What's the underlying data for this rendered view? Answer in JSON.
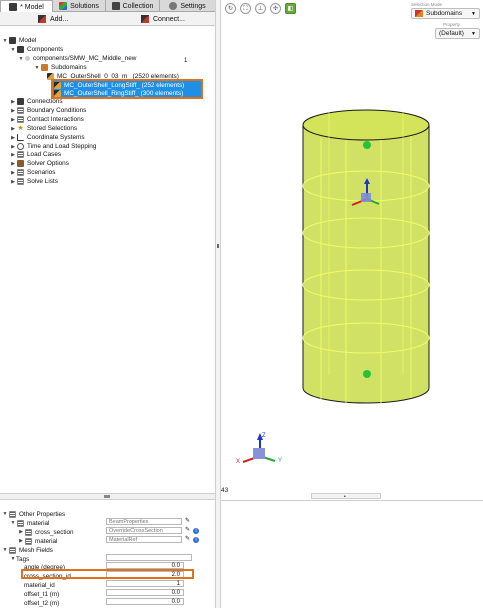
{
  "tabs": [
    {
      "label": "* Model",
      "icon": "model-icon"
    },
    {
      "label": "Solutions",
      "icon": "solutions-icon"
    },
    {
      "label": "Collection",
      "icon": "collection-icon"
    },
    {
      "label": "Settings",
      "icon": "settings-icon"
    }
  ],
  "toolbar": {
    "add_label": "Add...",
    "connect_label": "Connect..."
  },
  "tree": {
    "model": "Model",
    "components": "Components",
    "component_file": "components/SMW_MC_Middle_new",
    "component_count": "1",
    "subdomains": "Subdomains",
    "sub1": "MC_OuterShell_0_03_m_ (2520 elements)",
    "sub2": "MC_OuterShell_LongStiff_ (252 elements)",
    "sub3": "MC_OuterShell_RingStiff_ (300 elements)",
    "connections": "Connections",
    "boundary": "Boundary Conditions",
    "contact": "Contact Interactions",
    "stored": "Stored Selections",
    "coords": "Coordinate Systems",
    "time": "Time and Load Stepping",
    "loadcases": "Load Cases",
    "solver": "Solver Options",
    "scenarios": "Scenarios",
    "solvelists": "Solve Lists"
  },
  "props": {
    "other": "Other Properties",
    "material": "material",
    "material_value": "BeamProperties",
    "cross_section": "cross_section",
    "cross_section_value": "OverrideCrossSection",
    "material2": "material",
    "material2_value": "MaterialRef",
    "mesh_fields": "Mesh Fields",
    "tags": "Tags",
    "angle_label": "angle (degree)",
    "angle_value": "0.0",
    "csid_label": "cross_section_id",
    "csid_value": "2.0",
    "matid_label": "material_id",
    "matid_value": "1",
    "t1_label": "offset_t1 (m)",
    "t1_value": "0.0",
    "t2_label": "offset_t2 (m)",
    "t2_value": "0.0"
  },
  "viewport": {
    "selection_mode_label": "Selection Mode",
    "selection_mode_value": "Subdomains",
    "property_label": "Property",
    "property_value": "(Default)",
    "frame_number": "43",
    "model_color": "#c8dc4a",
    "edge_color": "#1a1a1a",
    "axis_labels": {
      "z": "Z",
      "y": "Y",
      "x": "X"
    }
  }
}
